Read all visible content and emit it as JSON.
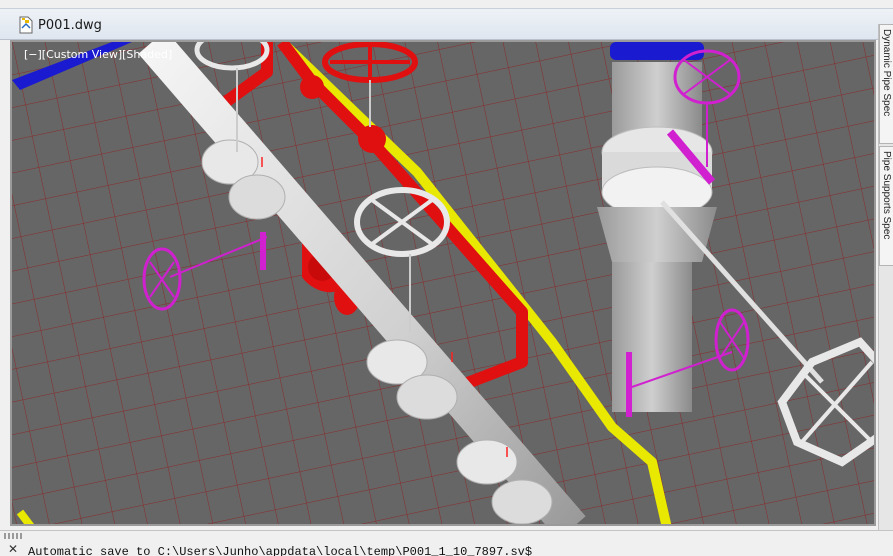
{
  "document": {
    "title": "P001.dwg"
  },
  "viewport": {
    "label": "[−][Custom View][Shaded]"
  },
  "palettes": {
    "tabs": [
      "Dynamic Pipe Spec",
      "Pipe Supports Spec"
    ]
  },
  "command_line": {
    "text": "Automatic save to C:\\Users\\Junho\\appdata\\local\\temp\\P001_1_10_7897.sv$"
  },
  "colors": {
    "background": "#666666",
    "grid": "#8a2a2a",
    "main_pipe": "#d9d9d9",
    "red_pipe": "#e01010",
    "yellow_pipe": "#e8e800",
    "magenta_valve": "#d020d0",
    "blue_equipment": "#1a1ad0"
  },
  "icons": {
    "document": "dwg-file-icon",
    "close": "close-icon"
  }
}
